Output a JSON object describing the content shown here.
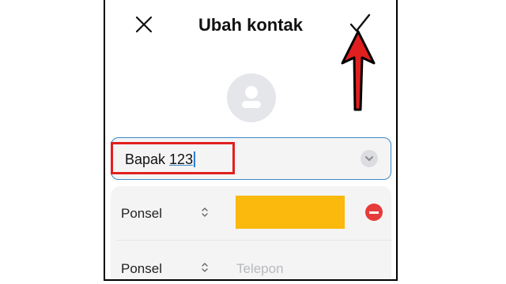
{
  "header": {
    "title": "Ubah kontak",
    "close_icon": "close-icon",
    "confirm_icon": "check-icon"
  },
  "annotation_color": "#e11f1f",
  "contact": {
    "name_prefix": "Bapak ",
    "name_suffix": "123",
    "avatar_icon": "person-icon",
    "expand_icon": "chevron-down-icon"
  },
  "phones": [
    {
      "label": "Ponsel",
      "value_hidden_color": "#fbb80d",
      "remove_icon": "minus-circle-icon"
    },
    {
      "label": "Ponsel",
      "placeholder": "Telepon"
    }
  ]
}
